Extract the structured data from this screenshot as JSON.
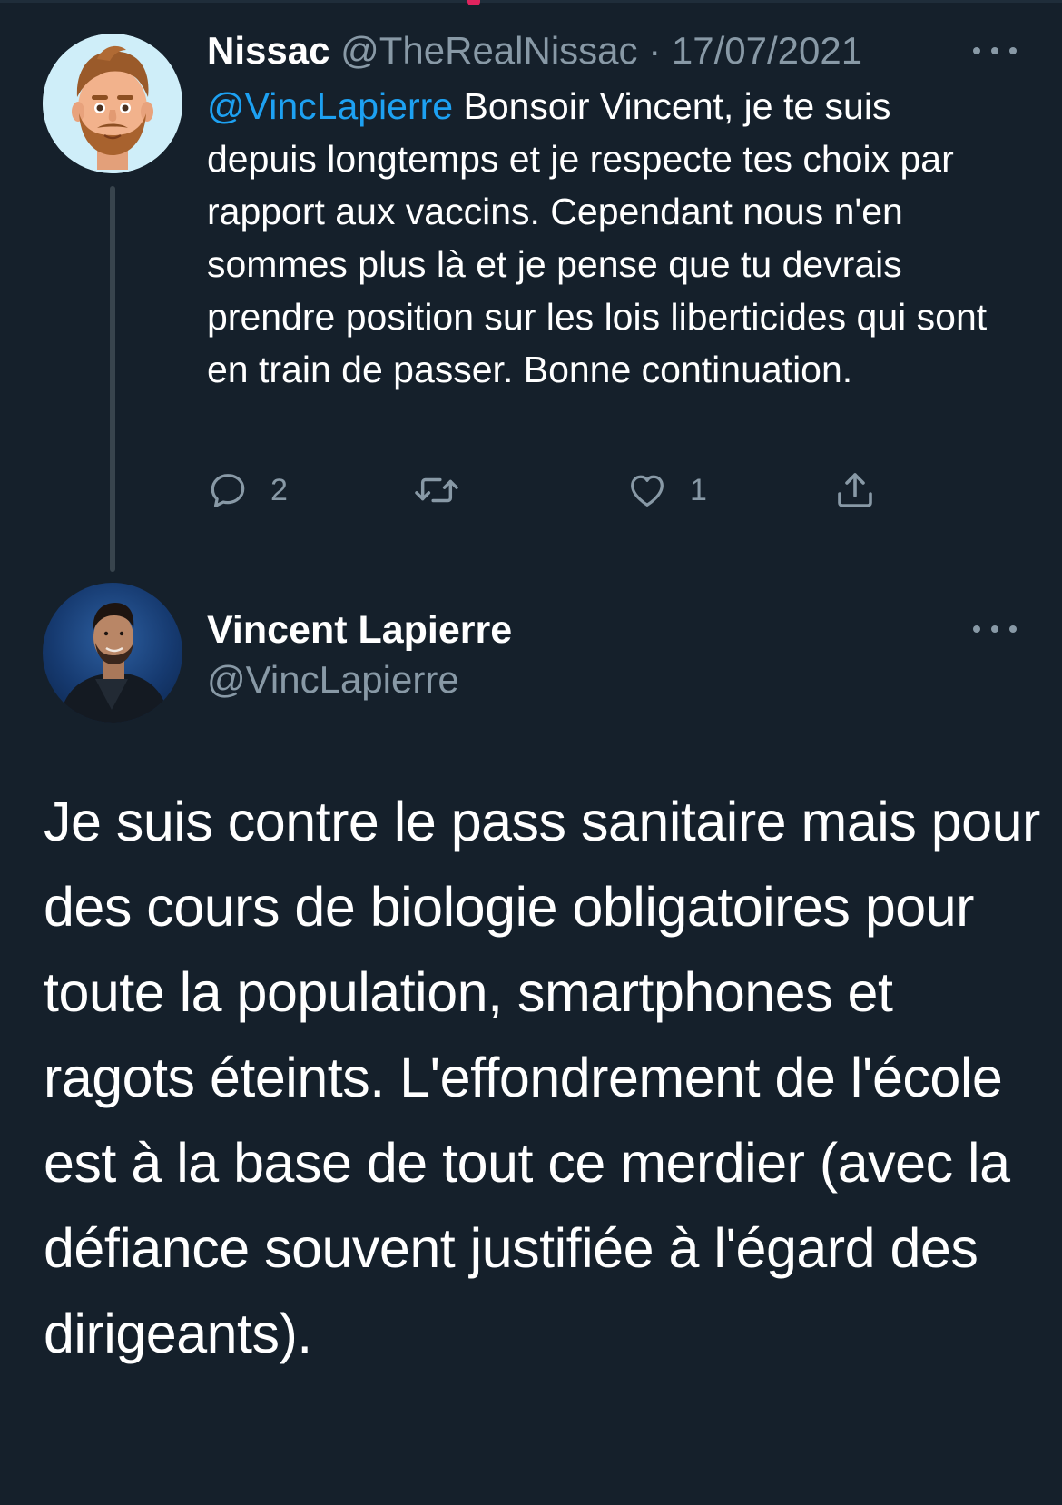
{
  "parent_tweet": {
    "display_name": "Nissac",
    "handle": "@TheRealNissac",
    "separator": "·",
    "date": "17/07/2021",
    "avatar_icon": "memoji-avatar-icon",
    "text_mention": "@VincLapierre",
    "text_body": " Bonsoir Vincent, je te suis depuis longtemps et je respecte tes choix par rapport aux vaccins. Cependant nous n'en sommes plus là et je pense que tu devrais prendre position sur les lois liberticides qui sont en train de passer. Bonne continuation.",
    "reply_count": "2",
    "like_count": "1"
  },
  "main_tweet": {
    "display_name": "Vincent Lapierre",
    "handle": "@VincLapierre",
    "avatar_icon": "profile-photo-icon",
    "text": "Je suis contre le pass sanitaire mais pour des cours de biologie obligatoires pour toute la population, smartphones et ragots éteints. L'effondrement de l'école est à la base de tout ce merdier (avec la défiance souvent justifiée à l'égard des dirigeants)."
  },
  "colors": {
    "background": "#15202b",
    "text_primary": "#ffffff",
    "text_secondary": "#8899a6",
    "link": "#1da1f2",
    "thread_line": "#38444d"
  }
}
